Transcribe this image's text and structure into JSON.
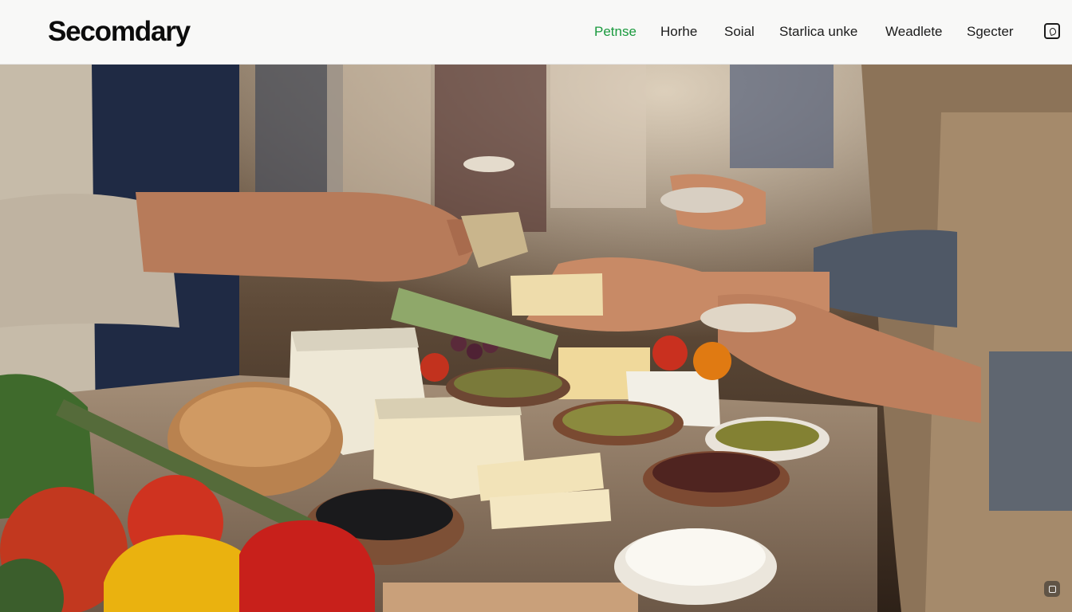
{
  "header": {
    "brand": "Secomdary",
    "nav": [
      {
        "label": "Petnse",
        "active": true
      },
      {
        "label": "Horhe",
        "active": false
      },
      {
        "label": "Soial",
        "active": false
      },
      {
        "label": "Starlica unke",
        "active": false
      },
      {
        "label": "Weadlete",
        "active": false
      },
      {
        "label": "Sgecter",
        "active": false
      }
    ],
    "accent_color": "#1a9a3e",
    "cart_icon": "shopping-bag-icon"
  },
  "hero": {
    "image_description_icon": "photo",
    "corner_icon": "expand-icon"
  }
}
